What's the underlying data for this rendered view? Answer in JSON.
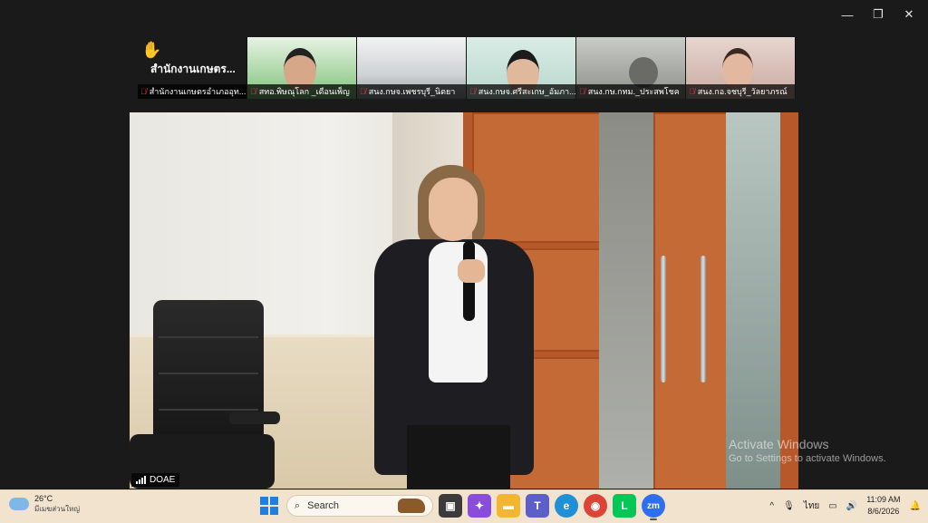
{
  "window": {
    "controls": {
      "minimize": "—",
      "restore": "❐",
      "close": "✕"
    }
  },
  "participants": [
    {
      "display": "สำนักงานเกษตร...",
      "label": "สำนักงานเกษตรอำเภออุท...",
      "raised_hand": true,
      "muted": true
    },
    {
      "label": "สทอ.พิษณุโลก _เดือนเพ็ญ",
      "muted": true
    },
    {
      "label": "สนง.กษจ.เพชรบุรี_นิตยา",
      "muted": true
    },
    {
      "label": "สนง.กษจ.ศรีสะเกษ_อัมภา...",
      "muted": true
    },
    {
      "label": "สนง.กษ.กทม._ประสพโชค",
      "muted": true
    },
    {
      "label": "สนง.กอ.จชบุรี_วัลยาภรณ์",
      "muted": true
    }
  ],
  "main_video": {
    "label": "DOAE"
  },
  "watermark": {
    "title": "Activate Windows",
    "subtitle": "Go to Settings to activate Windows."
  },
  "taskbar": {
    "weather": {
      "temp": "26°C",
      "location": "มีเมฆส่วนใหญ่"
    },
    "search_placeholder": "Search",
    "apps": [
      {
        "name": "task-view",
        "glyph": "▣",
        "color": "#333333"
      },
      {
        "name": "copilot",
        "glyph": "✦",
        "color": "#8a4ddb"
      },
      {
        "name": "file-explorer",
        "glyph": "▬",
        "color": "#f2b632"
      },
      {
        "name": "teams",
        "glyph": "T",
        "color": "#5b5fc7"
      },
      {
        "name": "edge",
        "glyph": "e",
        "color": "#1f8fd6"
      },
      {
        "name": "chrome",
        "glyph": "◉",
        "color": "#db4437"
      },
      {
        "name": "line",
        "glyph": "L",
        "color": "#06c755"
      },
      {
        "name": "zoom",
        "glyph": "zm",
        "color": "#2d6ff0"
      }
    ],
    "tray": {
      "chevron": "^",
      "mic": "🎙",
      "language": "ไทย",
      "volume": "🔊",
      "time": "11:09 AM",
      "date": "8/6/2026"
    }
  }
}
